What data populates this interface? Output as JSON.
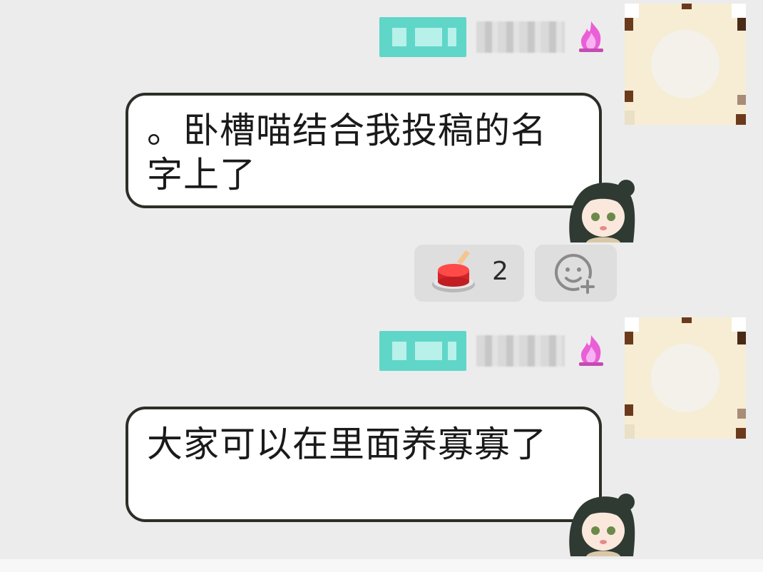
{
  "messages": [
    {
      "text": "。卧槽喵结合我投稿的名字上了",
      "reactions": [
        {
          "emoji": "red-button-icon",
          "count": "2"
        }
      ],
      "add_reaction_icon": "add-emoji-icon"
    },
    {
      "text": "大家可以在里面养寡寡了"
    }
  ],
  "colors": {
    "background": "#ececec",
    "bubble_border": "#2b2f28",
    "name_tag": "#5fd6c8",
    "avatar_bg": "#f6edd4",
    "reaction_bg": "#dedede"
  }
}
